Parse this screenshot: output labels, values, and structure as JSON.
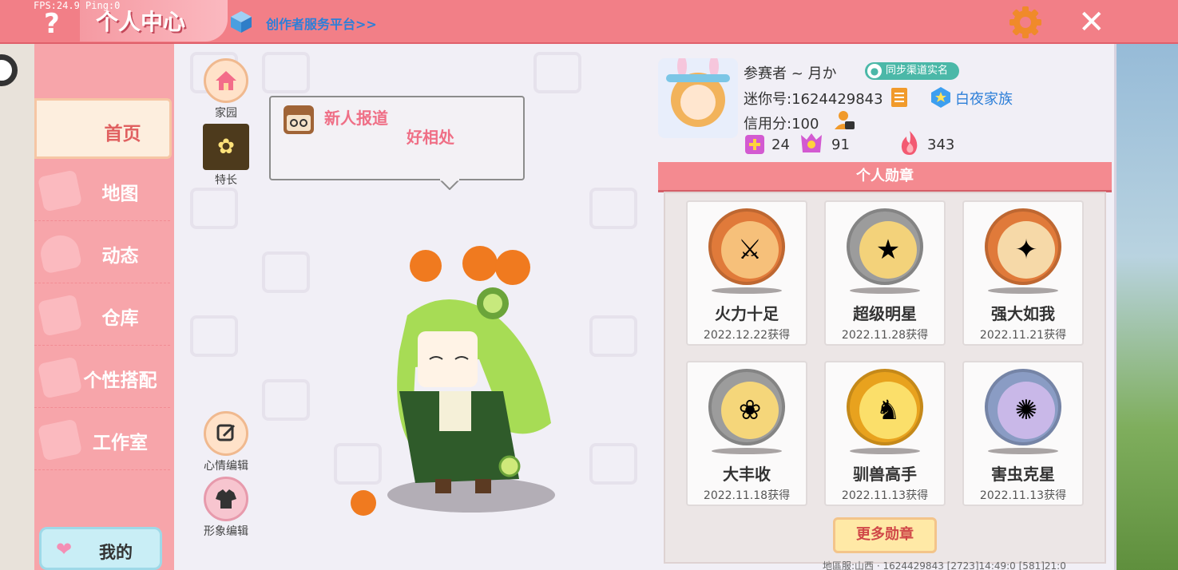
{
  "topbar": {
    "fps_text": "FPS:24.9  Ping:0",
    "help_glyph": "?",
    "title": "个人中心",
    "creator_link": "创作者服务平台>>",
    "close_glyph": "✕"
  },
  "sidebar": {
    "items": [
      {
        "label": "首页",
        "active": true
      },
      {
        "label": "地图"
      },
      {
        "label": "动态"
      },
      {
        "label": "仓库"
      },
      {
        "label": "个性搭配"
      },
      {
        "label": "工作室"
      }
    ],
    "mine_label": "我的"
  },
  "main": {
    "side_buttons": {
      "home_label": "家园",
      "skill_label": "特长",
      "mood_label": "心情编辑",
      "look_label": "形象编辑"
    },
    "bubble": {
      "title": "新人报道",
      "text": "好相处"
    }
  },
  "profile": {
    "name": "参赛者 ~ 月か",
    "sync_badge": "同步渠道实名",
    "mini_id": "迷你号:1624429843",
    "family": "白夜家族",
    "credit": "信用分:100",
    "stats": [
      {
        "icon": "plus-card-icon",
        "value": "24"
      },
      {
        "icon": "fans-icon",
        "value": "91"
      },
      {
        "icon": "flame-icon",
        "value": "343"
      }
    ]
  },
  "medals": {
    "header": "个人勋章",
    "items": [
      {
        "name": "火力十足",
        "date": "2022.12.22获得",
        "ring": "#e07a3a",
        "fill": "#f6c07a",
        "icon": "treasure-chest-icon"
      },
      {
        "name": "超级明星",
        "date": "2022.11.28获得",
        "ring": "#9c9c9c",
        "fill": "#f3d27a",
        "icon": "star-character-icon"
      },
      {
        "name": "强大如我",
        "date": "2022.11.21获得",
        "ring": "#e07a3a",
        "fill": "#f6d9a8",
        "icon": "weapons-icon"
      },
      {
        "name": "大丰收",
        "date": "2022.11.18获得",
        "ring": "#9c9c9c",
        "fill": "#f5d67a",
        "icon": "harvest-icon"
      },
      {
        "name": "驯兽高手",
        "date": "2022.11.13获得",
        "ring": "#e8a21e",
        "fill": "#fbdf6a",
        "icon": "tamer-icon"
      },
      {
        "name": "害虫克星",
        "date": "2022.11.13获得",
        "ring": "#8a9cc4",
        "fill": "#c9b8e8",
        "icon": "bug-icon"
      }
    ],
    "more_label": "更多勋章"
  },
  "footer": {
    "text": "地區服:山西  ·    1624429843    [2723]14:49:0   [581]21:0"
  }
}
